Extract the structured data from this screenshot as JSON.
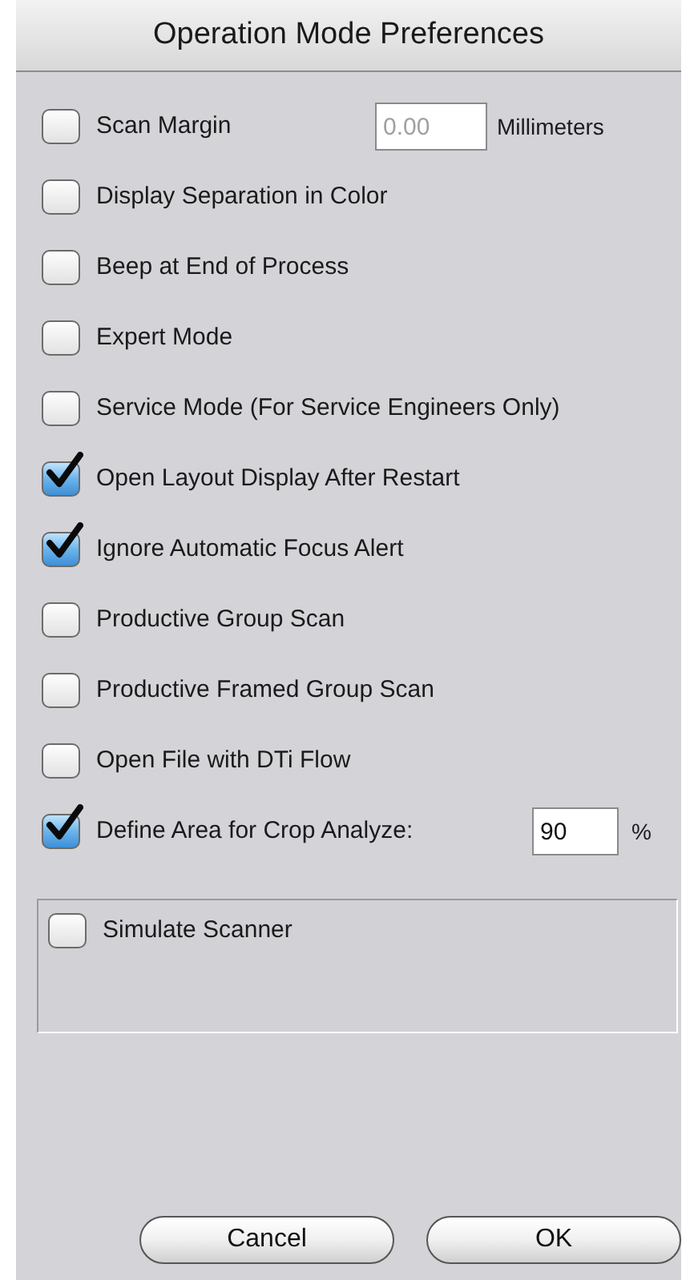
{
  "window": {
    "title": "Operation Mode Preferences"
  },
  "options": [
    {
      "kind": "field",
      "label": "Scan Margin",
      "checked": false,
      "value": "0.00",
      "unit": "Millimeters",
      "field_disabled": true
    },
    {
      "kind": "plain",
      "label": "Display Separation in Color",
      "checked": false
    },
    {
      "kind": "plain",
      "label": "Beep at End of Process",
      "checked": false
    },
    {
      "kind": "plain",
      "label": "Expert Mode",
      "checked": false
    },
    {
      "kind": "plain",
      "label": "Service Mode (For Service Engineers Only)",
      "checked": false
    },
    {
      "kind": "plain",
      "label": "Open Layout Display After Restart",
      "checked": true
    },
    {
      "kind": "plain",
      "label": "Ignore Automatic Focus Alert",
      "checked": true
    },
    {
      "kind": "plain",
      "label": "Productive Group Scan",
      "checked": false
    },
    {
      "kind": "plain",
      "label": "Productive Framed Group Scan",
      "checked": false
    },
    {
      "kind": "plain",
      "label": "Open File with DTi Flow",
      "checked": false
    },
    {
      "kind": "field",
      "label": "Define Area for Crop Analyze:",
      "checked": true,
      "value": "90",
      "unit": "%",
      "field_disabled": false
    }
  ],
  "group": {
    "label": "Simulate Scanner",
    "checked": false
  },
  "buttons": [
    "Cancel",
    "OK"
  ]
}
